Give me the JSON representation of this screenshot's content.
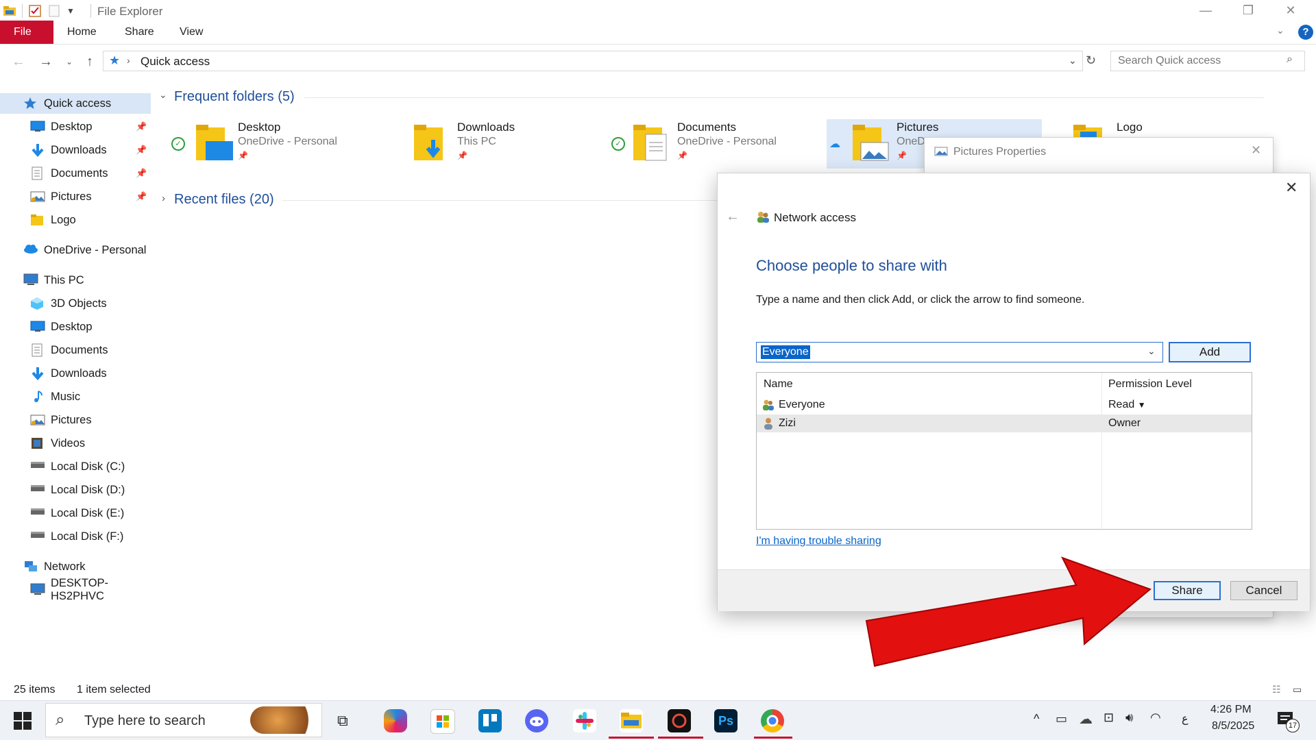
{
  "window": {
    "title": "File Explorer"
  },
  "ribbon": {
    "tabs": [
      "File",
      "Home",
      "Share",
      "View"
    ]
  },
  "address": {
    "path": "Quick access",
    "search_placeholder": "Search Quick access"
  },
  "sidebar": {
    "items": [
      {
        "label": "Quick access",
        "icon": "star-icon",
        "pinned": false,
        "level": 0
      },
      {
        "label": "Desktop",
        "icon": "desktop-icon",
        "pinned": true,
        "level": 1
      },
      {
        "label": "Downloads",
        "icon": "download-icon",
        "pinned": true,
        "level": 1
      },
      {
        "label": "Documents",
        "icon": "document-icon",
        "pinned": true,
        "level": 1
      },
      {
        "label": "Pictures",
        "icon": "pictures-icon",
        "pinned": true,
        "level": 1
      },
      {
        "label": "Logo",
        "icon": "folder-icon",
        "pinned": false,
        "level": 1
      },
      {
        "label": "OneDrive - Personal",
        "icon": "cloud-icon",
        "pinned": false,
        "level": 0
      },
      {
        "label": "This PC",
        "icon": "pc-icon",
        "pinned": false,
        "level": 0
      },
      {
        "label": "3D Objects",
        "icon": "cube-icon",
        "pinned": false,
        "level": 1
      },
      {
        "label": "Desktop",
        "icon": "desktop-icon",
        "pinned": false,
        "level": 1
      },
      {
        "label": "Documents",
        "icon": "document-icon",
        "pinned": false,
        "level": 1
      },
      {
        "label": "Downloads",
        "icon": "download-icon",
        "pinned": false,
        "level": 1
      },
      {
        "label": "Music",
        "icon": "music-icon",
        "pinned": false,
        "level": 1
      },
      {
        "label": "Pictures",
        "icon": "pictures-icon",
        "pinned": false,
        "level": 1
      },
      {
        "label": "Videos",
        "icon": "video-icon",
        "pinned": false,
        "level": 1
      },
      {
        "label": "Local Disk (C:)",
        "icon": "disk-icon",
        "pinned": false,
        "level": 1
      },
      {
        "label": "Local Disk (D:)",
        "icon": "disk-icon",
        "pinned": false,
        "level": 1
      },
      {
        "label": "Local Disk (E:)",
        "icon": "disk-icon",
        "pinned": false,
        "level": 1
      },
      {
        "label": "Local Disk (F:)",
        "icon": "disk-icon",
        "pinned": false,
        "level": 1
      },
      {
        "label": "Network",
        "icon": "network-icon",
        "pinned": false,
        "level": 0
      },
      {
        "label": "DESKTOP-HS2PHVC",
        "icon": "pc-icon",
        "pinned": false,
        "level": 1
      }
    ]
  },
  "main": {
    "frequent_header": "Frequent folders (5)",
    "recent_header": "Recent files (20)",
    "folders": [
      {
        "name": "Desktop",
        "sub": "OneDrive - Personal"
      },
      {
        "name": "Downloads",
        "sub": "This PC"
      },
      {
        "name": "Documents",
        "sub": "OneDrive - Personal"
      },
      {
        "name": "Pictures",
        "sub": "OneD"
      },
      {
        "name": "Logo",
        "sub": ""
      }
    ]
  },
  "properties_window": {
    "title": "Pictures Properties"
  },
  "dialog": {
    "header": "Network access",
    "heading": "Choose people to share with",
    "instruction": "Type a name and then click Add, or click the arrow to find someone.",
    "input_value": "Everyone",
    "add_label": "Add",
    "columns": [
      "Name",
      "Permission Level"
    ],
    "rows": [
      {
        "name": "Everyone",
        "permission": "Read"
      },
      {
        "name": "Zizi",
        "permission": "Owner"
      }
    ],
    "trouble_link": "I'm having trouble sharing",
    "share_label": "Share",
    "cancel_label": "Cancel"
  },
  "status": {
    "items": "25 items",
    "selected": "1 item selected"
  },
  "taskbar": {
    "search_placeholder": "Type here to search",
    "time": "4:26 PM",
    "date": "8/5/2025",
    "notification_count": "17"
  },
  "colors": {
    "accent": "#1f4e99",
    "file_tab": "#c8102e",
    "arrow": "#e31010",
    "selection": "#0a64c8"
  }
}
